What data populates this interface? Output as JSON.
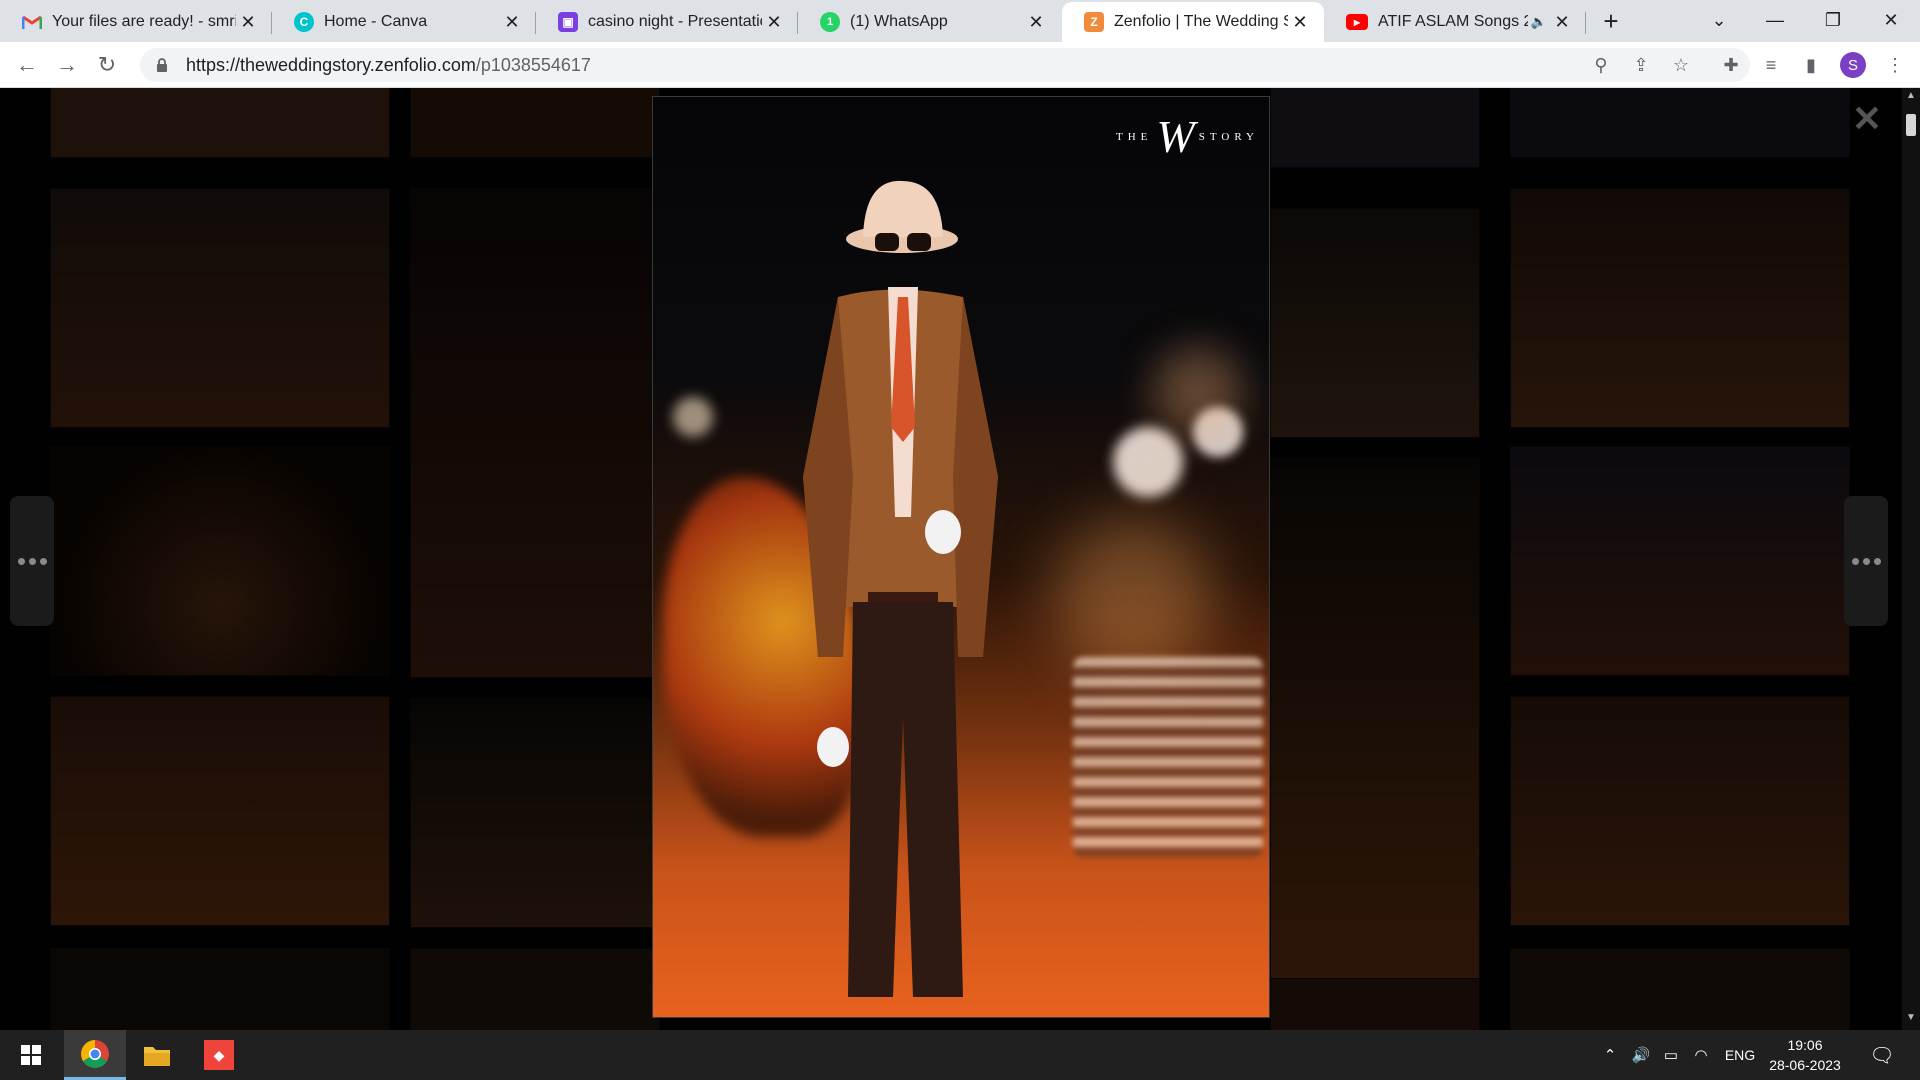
{
  "browser": {
    "tabs": [
      {
        "title": "Your files are ready! - smritt",
        "icon": "gmail-icon",
        "color": "#ea4335"
      },
      {
        "title": "Home - Canva",
        "icon": "canva-icon",
        "color": "#00c4cc"
      },
      {
        "title": "casino night - Presentation",
        "icon": "presentation-icon",
        "color": "#7b3fe4"
      },
      {
        "title": "(1) WhatsApp",
        "icon": "whatsapp-icon",
        "color": "#25d366"
      },
      {
        "title": "Zenfolio | The Wedding Sto",
        "icon": "zenfolio-icon",
        "color": "#f08a3c",
        "active": true
      },
      {
        "title": "ATIF ASLAM Songs 202",
        "icon": "youtube-icon",
        "color": "#ff0000",
        "audio": true
      }
    ],
    "url_host": "https://theweddingstory.zenfolio.com",
    "url_path": "/p1038554617",
    "profile_initial": "S"
  },
  "lightbox": {
    "logo_left": "THE",
    "logo_mark": "W",
    "logo_right": "STORY"
  },
  "taskbar": {
    "language": "ENG",
    "time": "19:06",
    "date": "28-06-2023"
  }
}
